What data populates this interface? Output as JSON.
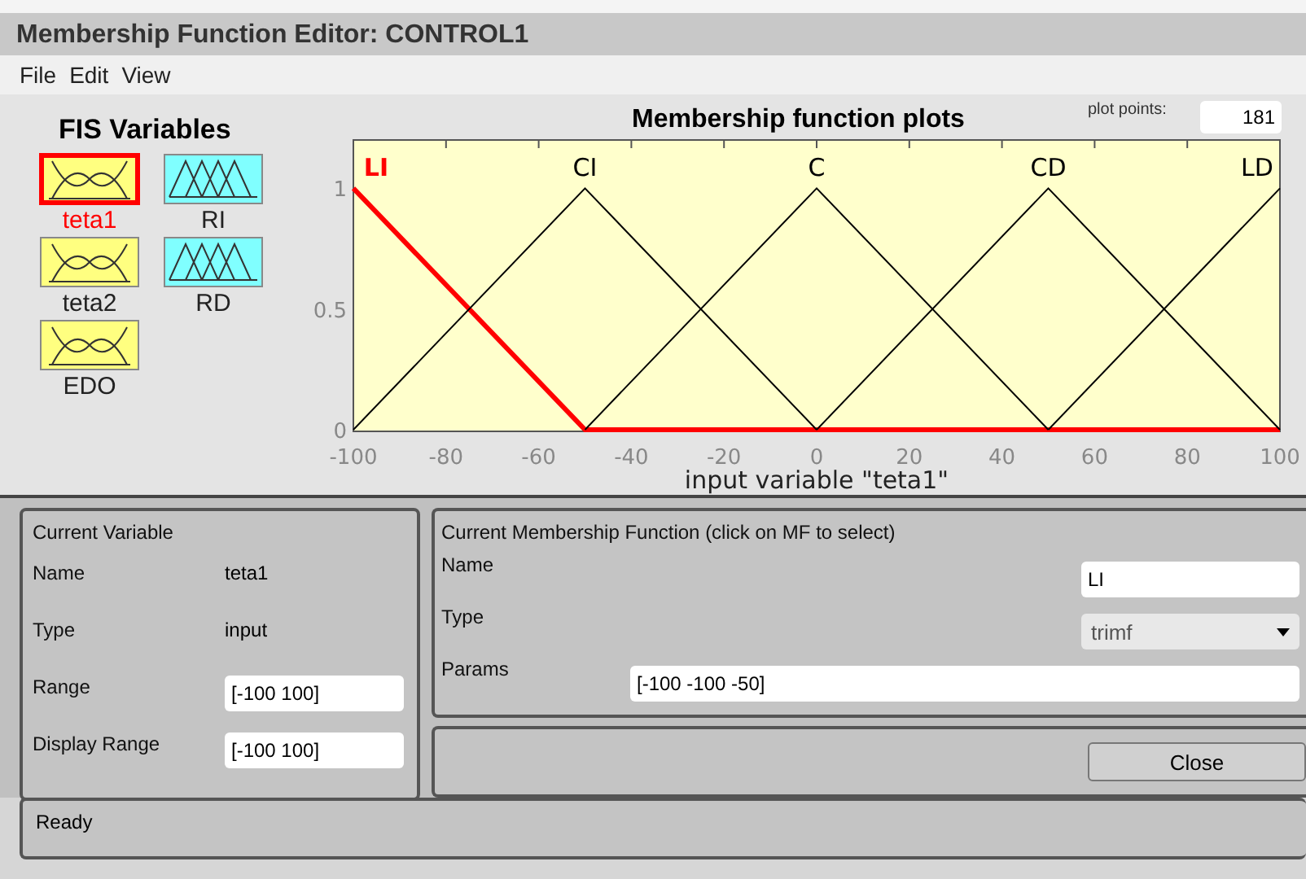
{
  "window": {
    "title": "Membership Function Editor: CONTROL1"
  },
  "menu": [
    "File",
    "Edit",
    "View"
  ],
  "fis_variables": {
    "title": "FIS Variables",
    "items": [
      {
        "name": "teta1",
        "kind": "input",
        "selected": true
      },
      {
        "name": "RI",
        "kind": "output",
        "selected": false
      },
      {
        "name": "teta2",
        "kind": "input",
        "selected": false
      },
      {
        "name": "RD",
        "kind": "output",
        "selected": false
      },
      {
        "name": "EDO",
        "kind": "input",
        "selected": false
      }
    ]
  },
  "plot": {
    "title": "Membership function plots",
    "plot_points_label": "plot points:",
    "plot_points": "181",
    "chart_data": {
      "type": "line",
      "xlabel": "input variable \"teta1\"",
      "x": [
        -100,
        -50,
        0,
        50,
        100
      ],
      "series": [
        {
          "name": "LI",
          "color": "#ff0000",
          "values": [
            1,
            0,
            0,
            0,
            0
          ]
        },
        {
          "name": "CI",
          "color": "#000000",
          "values": [
            0,
            1,
            0,
            null,
            null
          ]
        },
        {
          "name": "C",
          "color": "#000000",
          "values": [
            null,
            0,
            1,
            0,
            null
          ]
        },
        {
          "name": "CD",
          "color": "#000000",
          "values": [
            null,
            null,
            0,
            1,
            0
          ]
        },
        {
          "name": "LD",
          "color": "#000000",
          "values": [
            null,
            null,
            null,
            0,
            1
          ]
        }
      ],
      "xlim": [
        -100,
        100
      ],
      "ylim": [
        0,
        1.2
      ],
      "xticks": [
        -100,
        -80,
        -60,
        -40,
        -20,
        0,
        20,
        40,
        60,
        80,
        100
      ],
      "yticks": [
        0,
        {
          "value": 0.5,
          "label": "0.5"
        },
        1
      ]
    }
  },
  "current_variable": {
    "title": "Current Variable",
    "fields": [
      {
        "label": "Name",
        "value": "teta1",
        "kind": "text"
      },
      {
        "label": "Type",
        "value": "input",
        "kind": "text"
      },
      {
        "label": "Range",
        "value": "[-100 100]",
        "kind": "input"
      },
      {
        "label": "Display Range",
        "value": "[-100 100]",
        "kind": "input"
      }
    ]
  },
  "current_mf": {
    "title": "Current Membership Function (click on MF to select)",
    "name_label": "Name",
    "name": "LI",
    "type_label": "Type",
    "type": "trimf",
    "params_label": "Params",
    "params": "[-100 -100 -50]"
  },
  "close_button": "Close",
  "status_bar": "Ready"
}
